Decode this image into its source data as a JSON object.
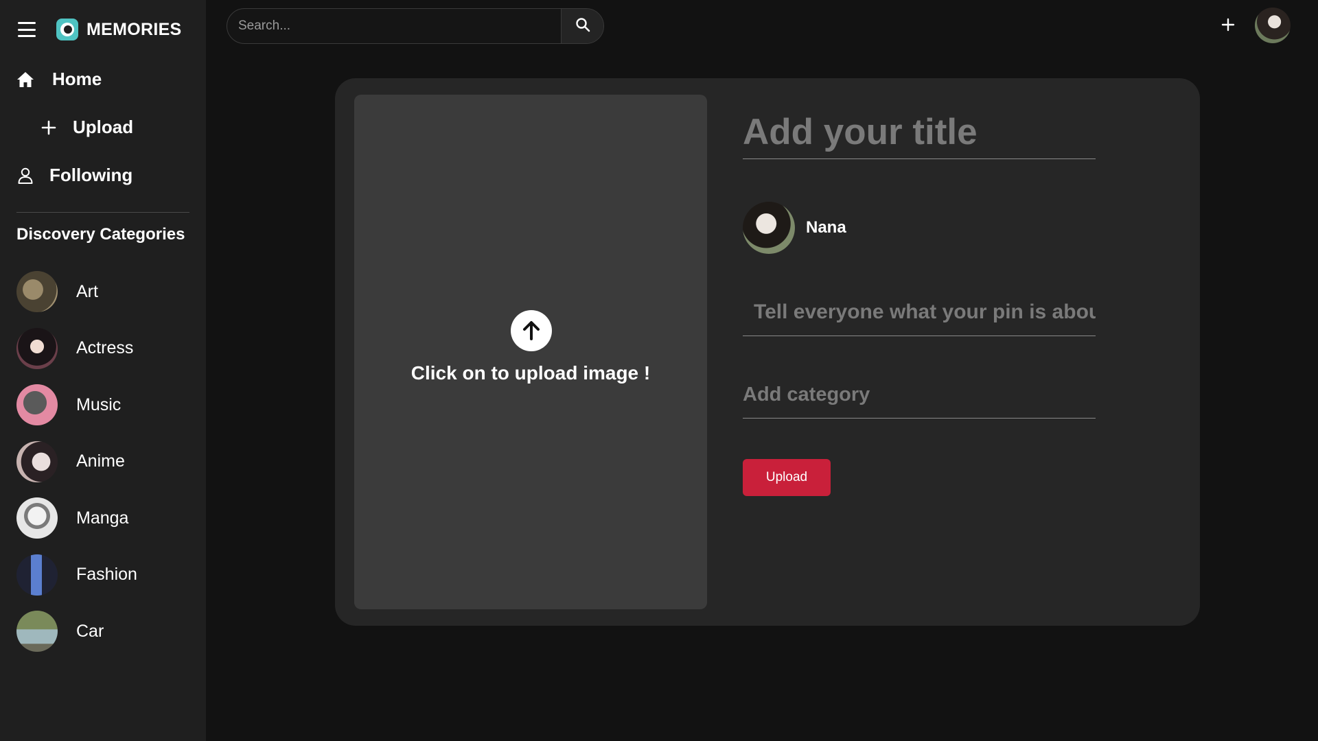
{
  "brand": {
    "name": "MEMORIES"
  },
  "search": {
    "placeholder": "Search..."
  },
  "nav": {
    "home": "Home",
    "upload": "Upload",
    "following": "Following"
  },
  "categories": {
    "heading": "Discovery Categories",
    "items": [
      {
        "label": "Art",
        "avatar_color": "#6f6350"
      },
      {
        "label": "Actress",
        "avatar_color": "#3a2d33"
      },
      {
        "label": "Music",
        "avatar_color": "#e48aa3"
      },
      {
        "label": "Anime",
        "avatar_color": "#b79ba0"
      },
      {
        "label": "Manga",
        "avatar_color": "#cfcfcf"
      },
      {
        "label": "Fashion",
        "avatar_color": "#4e6fb5"
      },
      {
        "label": "Car",
        "avatar_color": "#7f9a9a"
      }
    ]
  },
  "form": {
    "title_placeholder": "Add your title",
    "author_name": "Nana",
    "about_placeholder": "Tell everyone what your pin is about",
    "category_placeholder": "Add category",
    "submit_label": "Upload"
  },
  "dropzone": {
    "text": "Click on to upload image !"
  },
  "colors": {
    "page_bg": "#121212",
    "sidebar_bg": "#1f1f1f",
    "card_bg": "#262626",
    "dropzone_bg": "#3b3b3b",
    "accent": "#c9203a",
    "logo": "#4fc3c2"
  },
  "icons": {
    "menu": "hamburger-icon",
    "home": "home-icon",
    "upload": "plus-icon",
    "following": "user-icon",
    "search": "search-icon",
    "add": "plus-icon",
    "dropzone": "arrow-up-icon"
  }
}
